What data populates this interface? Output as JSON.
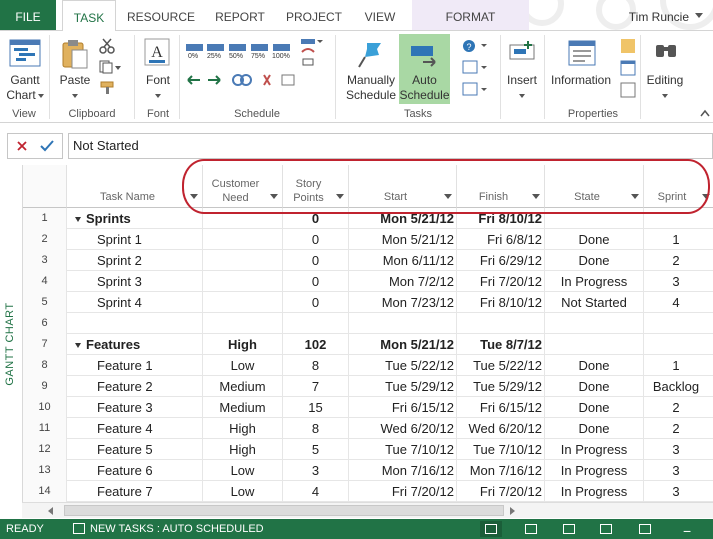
{
  "ribbon_tabs": {
    "file": "FILE",
    "task": "TASK",
    "resource": "RESOURCE",
    "report": "REPORT",
    "project": "PROJECT",
    "view": "VIEW",
    "format": "FORMAT"
  },
  "user": {
    "name": "Tim Runcie"
  },
  "ribbon": {
    "view_group": {
      "gantt_chart": "Gantt",
      "gantt_chart_2": "Chart",
      "label": "View"
    },
    "clipboard_group": {
      "paste": "Paste",
      "label": "Clipboard"
    },
    "font_group": {
      "font": "Font",
      "label": "Font"
    },
    "schedule_group": {
      "p0": "0%",
      "p25": "25%",
      "p50": "50%",
      "p75": "75%",
      "p100": "100%",
      "label": "Schedule"
    },
    "tasks_group": {
      "manually": "Manually",
      "manually_2": "Schedule",
      "auto": "Auto",
      "auto_2": "Schedule",
      "label": "Tasks"
    },
    "insert_group": {
      "insert": "Insert"
    },
    "properties_group": {
      "information": "Information",
      "label": "Properties"
    },
    "editing_group": {
      "editing": "Editing"
    },
    "colors": {
      "accent": "#217346",
      "auto_schedule_bg": "#a9d8a4",
      "format_tab_bg": "#f0eaf7",
      "highlight_oval": "#c0232f"
    }
  },
  "formula_bar": {
    "cancel_icon": "x-icon",
    "enter_icon": "checkmark-icon",
    "value": "Not Started"
  },
  "side_label": "GANTT CHART",
  "grid": {
    "headers": {
      "task_name": "Task Name",
      "customer_need_1": "Customer",
      "customer_need_2": "Need",
      "story_points_1": "Story",
      "story_points_2": "Points",
      "start": "Start",
      "finish": "Finish",
      "state": "State",
      "sprint": "Sprint"
    },
    "rows": [
      {
        "id": "1",
        "name": "Sprints",
        "need": "",
        "points": "0",
        "start": "Mon 5/21/12",
        "finish": "Fri 8/10/12",
        "state": "",
        "sprint": ""
      },
      {
        "id": "2",
        "name": "Sprint 1",
        "need": "",
        "points": "0",
        "start": "Mon 5/21/12",
        "finish": "Fri 6/8/12",
        "state": "Done",
        "sprint": "1"
      },
      {
        "id": "3",
        "name": "Sprint 2",
        "need": "",
        "points": "0",
        "start": "Mon 6/11/12",
        "finish": "Fri 6/29/12",
        "state": "Done",
        "sprint": "2"
      },
      {
        "id": "4",
        "name": "Sprint 3",
        "need": "",
        "points": "0",
        "start": "Mon 7/2/12",
        "finish": "Fri 7/20/12",
        "state": "In Progress",
        "sprint": "3"
      },
      {
        "id": "5",
        "name": "Sprint 4",
        "need": "",
        "points": "0",
        "start": "Mon 7/23/12",
        "finish": "Fri 8/10/12",
        "state": "Not Started",
        "sprint": "4"
      },
      {
        "id": "6",
        "name": "",
        "need": "",
        "points": "",
        "start": "",
        "finish": "",
        "state": "",
        "sprint": ""
      },
      {
        "id": "7",
        "name": "Features",
        "need": "High",
        "points": "102",
        "start": "Mon 5/21/12",
        "finish": "Tue 8/7/12",
        "state": "",
        "sprint": ""
      },
      {
        "id": "8",
        "name": "Feature 1",
        "need": "Low",
        "points": "8",
        "start": "Tue 5/22/12",
        "finish": "Tue 5/22/12",
        "state": "Done",
        "sprint": "1"
      },
      {
        "id": "9",
        "name": "Feature 2",
        "need": "Medium",
        "points": "7",
        "start": "Tue 5/29/12",
        "finish": "Tue 5/29/12",
        "state": "Done",
        "sprint": "Backlog"
      },
      {
        "id": "10",
        "name": "Feature 3",
        "need": "Medium",
        "points": "15",
        "start": "Fri 6/15/12",
        "finish": "Fri 6/15/12",
        "state": "Done",
        "sprint": "2"
      },
      {
        "id": "11",
        "name": "Feature 4",
        "need": "High",
        "points": "8",
        "start": "Wed 6/20/12",
        "finish": "Wed 6/20/12",
        "state": "Done",
        "sprint": "2"
      },
      {
        "id": "12",
        "name": "Feature 5",
        "need": "High",
        "points": "5",
        "start": "Tue 7/10/12",
        "finish": "Tue 7/10/12",
        "state": "In Progress",
        "sprint": "3"
      },
      {
        "id": "13",
        "name": "Feature 6",
        "need": "Low",
        "points": "3",
        "start": "Mon 7/16/12",
        "finish": "Mon 7/16/12",
        "state": "In Progress",
        "sprint": "3"
      },
      {
        "id": "14",
        "name": "Feature 7",
        "need": "Low",
        "points": "4",
        "start": "Fri 7/20/12",
        "finish": "Fri 7/20/12",
        "state": "In Progress",
        "sprint": "3"
      }
    ]
  },
  "status_bar": {
    "ready": "READY",
    "new_tasks": "NEW TASKS : AUTO SCHEDULED"
  }
}
